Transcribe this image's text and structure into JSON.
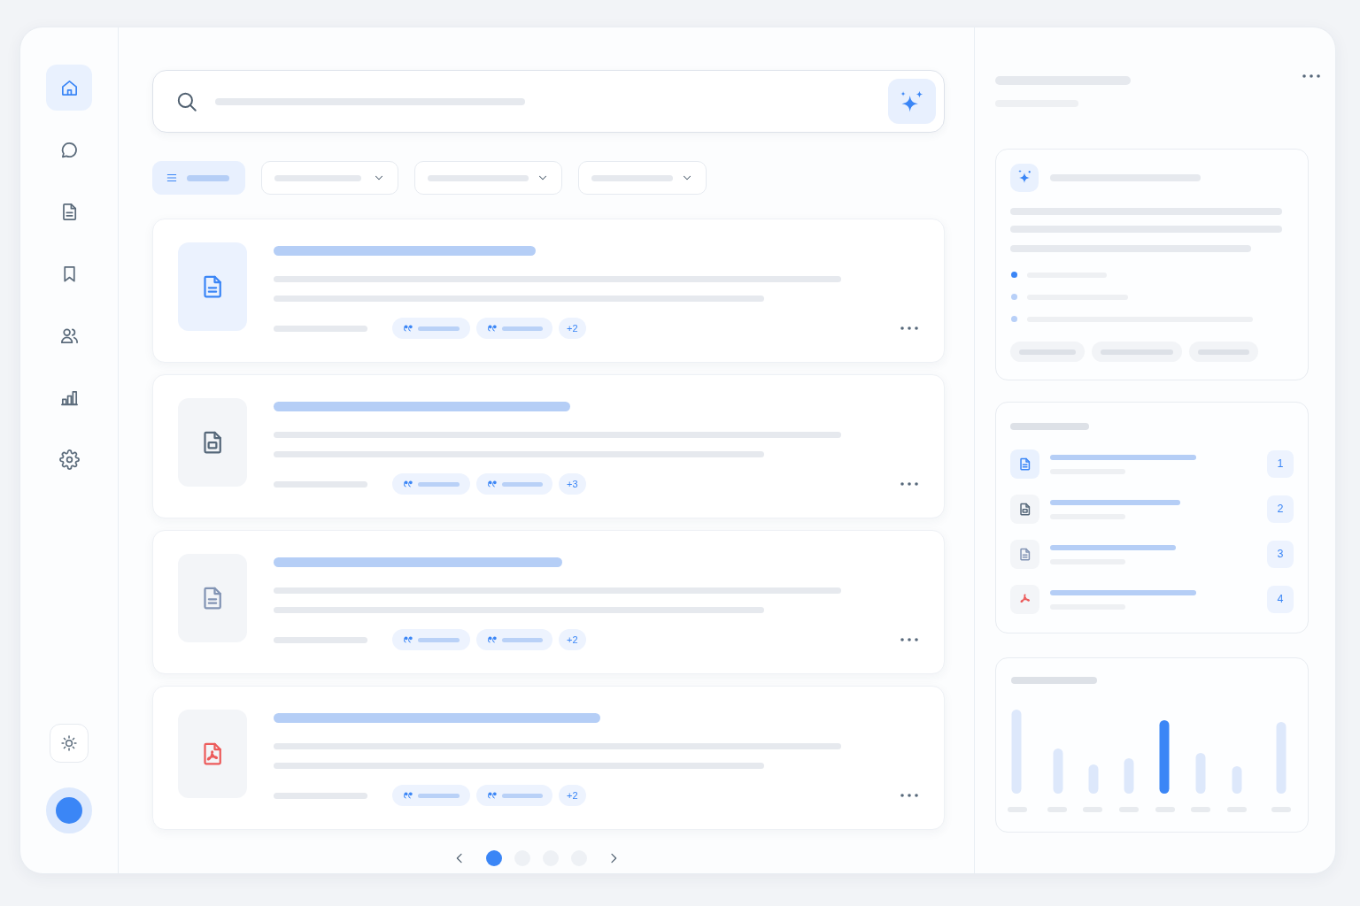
{
  "sidebar": {
    "items": [
      {
        "selected": true
      },
      {
        "selected": false
      },
      {
        "selected": false
      },
      {
        "selected": false
      },
      {
        "selected": false
      },
      {
        "selected": false
      },
      {
        "selected": false
      }
    ]
  },
  "filters": [
    {
      "kind": "view",
      "selected": true
    },
    {
      "kind": "dropdown",
      "selected": false
    },
    {
      "kind": "dropdown",
      "selected": false
    },
    {
      "kind": "dropdown",
      "selected": false
    }
  ],
  "results": [
    {
      "kind": "document",
      "selected": true,
      "more_citations": "+2"
    },
    {
      "kind": "slides",
      "selected": false,
      "more_citations": "+3"
    },
    {
      "kind": "document",
      "selected": false,
      "more_citations": "+2"
    },
    {
      "kind": "pdf",
      "selected": false,
      "more_citations": "+2"
    }
  ],
  "pagination": {
    "pages": [
      {
        "selected": true
      },
      {
        "selected": false
      },
      {
        "selected": false
      },
      {
        "selected": false
      }
    ]
  },
  "summary": {
    "points": [
      {
        "selected": true
      },
      {
        "selected": false
      },
      {
        "selected": false
      }
    ]
  },
  "sources": {
    "items": [
      {
        "kind": "document",
        "selected": true,
        "number": "1"
      },
      {
        "kind": "slides",
        "selected": false,
        "number": "2"
      },
      {
        "kind": "document",
        "selected": false,
        "number": "3"
      },
      {
        "kind": "pdf",
        "selected": false,
        "number": "4"
      }
    ]
  }
}
